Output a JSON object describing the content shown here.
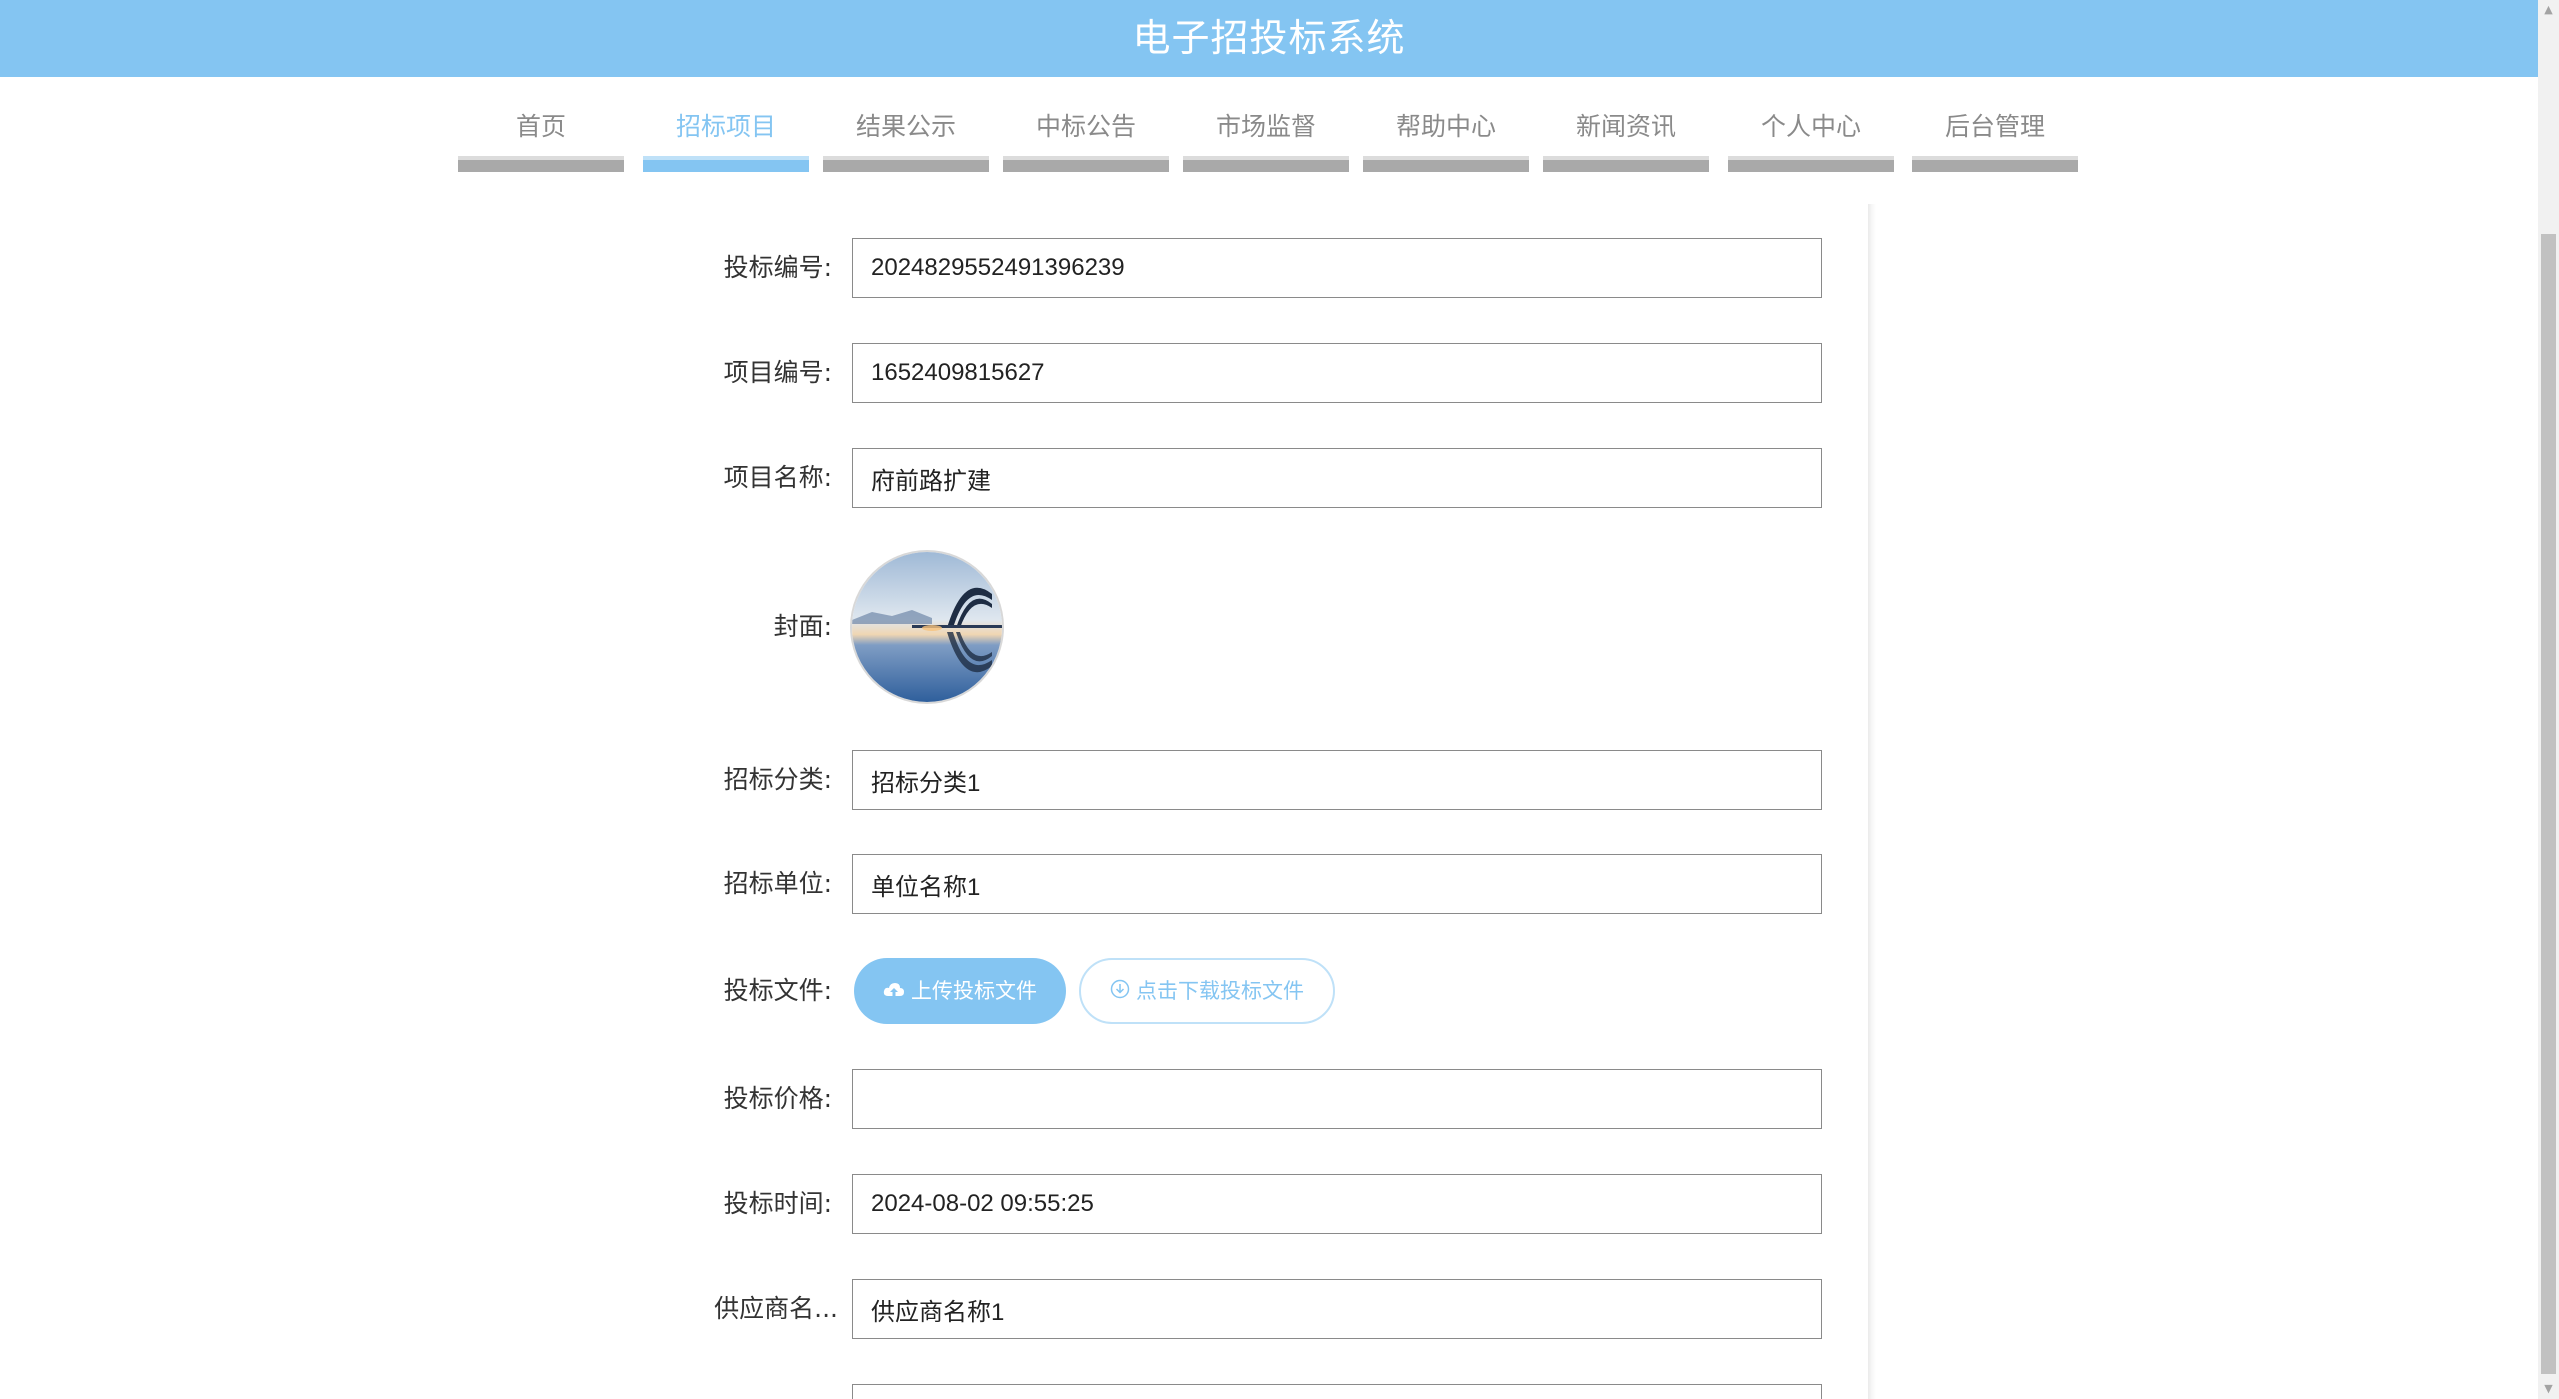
{
  "header": {
    "title": "电子招投标系统"
  },
  "nav": {
    "items": [
      {
        "label": "首页",
        "active": false
      },
      {
        "label": "招标项目",
        "active": true
      },
      {
        "label": "结果公示",
        "active": false
      },
      {
        "label": "中标公告",
        "active": false
      },
      {
        "label": "市场监督",
        "active": false
      },
      {
        "label": "帮助中心",
        "active": false
      },
      {
        "label": "新闻资讯",
        "active": false
      },
      {
        "label": "个人中心",
        "active": false
      },
      {
        "label": "后台管理",
        "active": false
      }
    ]
  },
  "form": {
    "bid_no": {
      "label": "投标编号:",
      "value": "2024829552491396239"
    },
    "project_no": {
      "label": "项目编号:",
      "value": "1652409815627"
    },
    "project_name": {
      "label": "项目名称:",
      "value": "府前路扩建"
    },
    "cover": {
      "label": "封面:"
    },
    "category": {
      "label": "招标分类:",
      "value": "招标分类1"
    },
    "unit": {
      "label": "招标单位:",
      "value": "单位名称1"
    },
    "bid_file": {
      "label": "投标文件:",
      "upload_label": "上传投标文件",
      "download_label": "点击下载投标文件"
    },
    "bid_price": {
      "label": "投标价格:",
      "value": ""
    },
    "bid_time": {
      "label": "投标时间:",
      "value": "2024-08-02 09:55:25"
    },
    "supplier": {
      "label": "供应商名...",
      "value": "供应商名称1"
    }
  },
  "colors": {
    "accent": "#84c5f2",
    "nav_bar": "#a9a9a9",
    "label_text": "#333333"
  }
}
